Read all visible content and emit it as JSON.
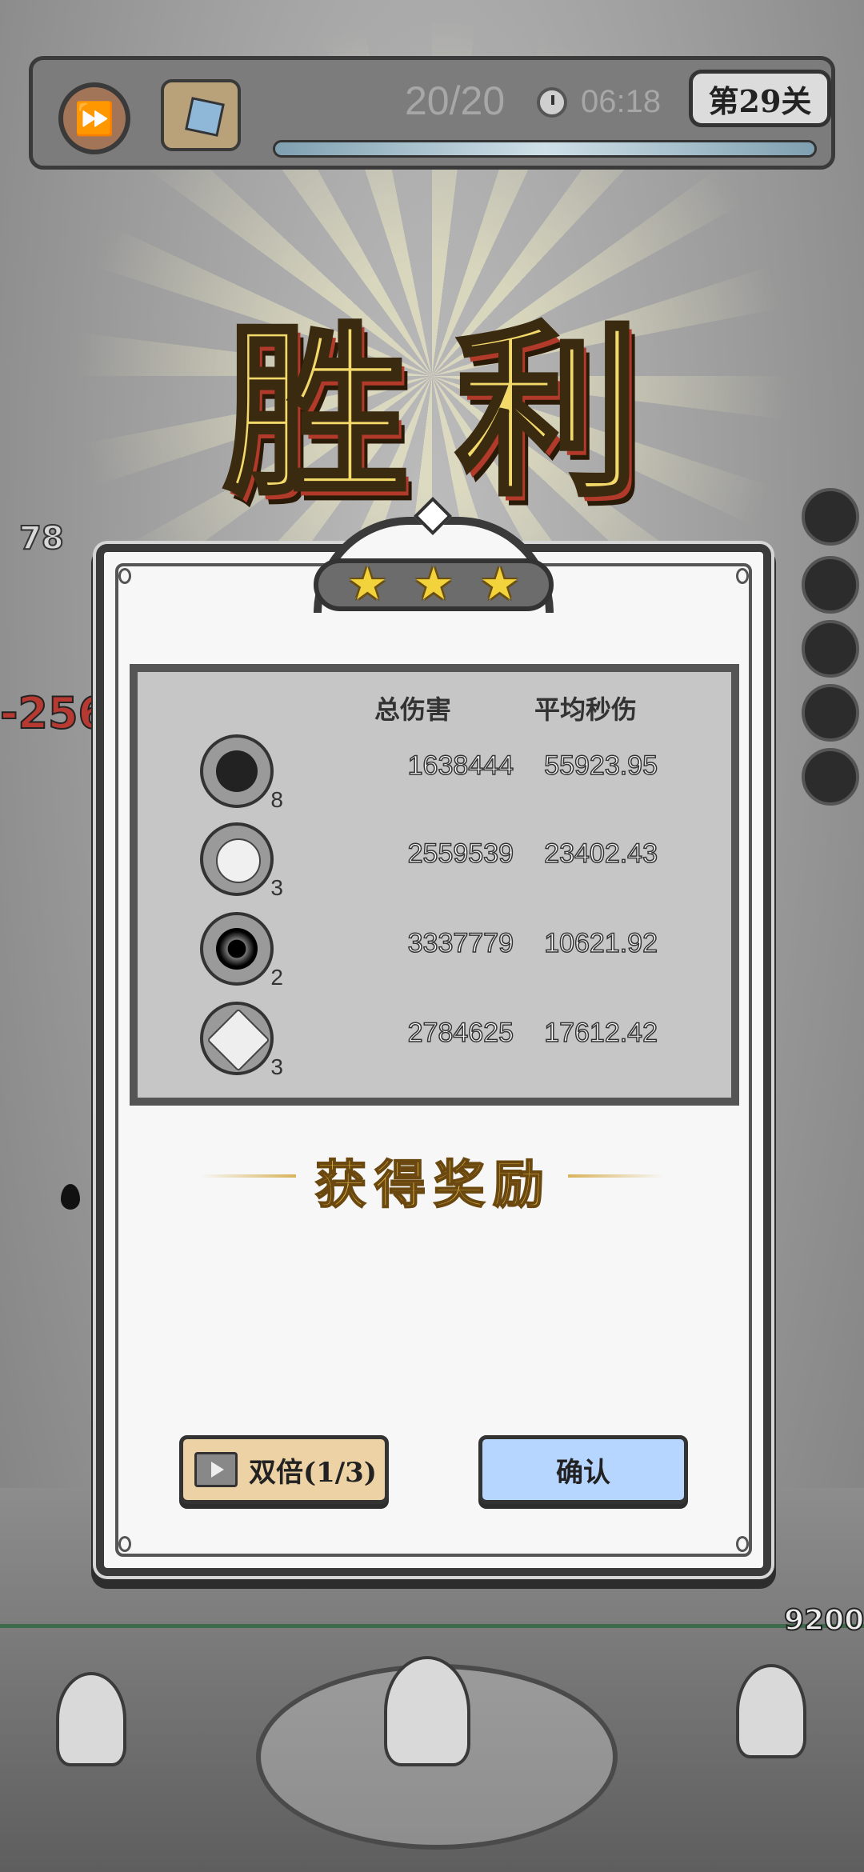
{
  "hud": {
    "wave_counter": "20/20",
    "timer": "06:18",
    "level": "第29关",
    "wave_progress_fraction": 1.0
  },
  "title": "胜利",
  "stars_earned": 3,
  "stars_total": 3,
  "stats": {
    "header_total": "总伤害",
    "header_dps": "平均秒伤",
    "rows": [
      {
        "icon": "bomb-icon",
        "level": "8",
        "total": "1638444",
        "dps": "55923.95"
      },
      {
        "icon": "ice-spirit-icon",
        "level": "3",
        "total": "2559539",
        "dps": "23402.43"
      },
      {
        "icon": "black-hole-icon",
        "level": "2",
        "total": "3337779",
        "dps": "10621.92"
      },
      {
        "icon": "crystal-icon",
        "level": "3",
        "total": "2784625",
        "dps": "17612.42"
      }
    ]
  },
  "reward_title": "获得奖励",
  "buttons": {
    "double": "双倍(1/3)",
    "confirm": "确认"
  },
  "background": {
    "left_counter": "78",
    "left_damage": "-256",
    "right_hp": "9200"
  },
  "colors": {
    "gold": "#f3d86a",
    "confirm": "#b6d6ff",
    "double": "#ecd2a4"
  }
}
